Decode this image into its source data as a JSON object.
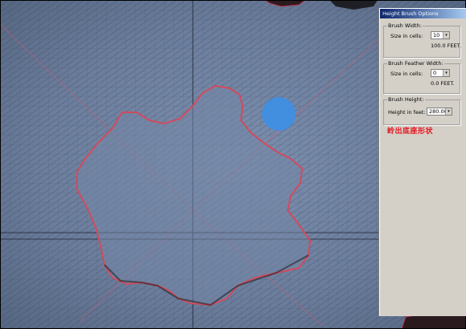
{
  "panel": {
    "title": "Height Brush Options",
    "brush_width": {
      "group_label": "Brush Width:",
      "field_label": "Size in cells:",
      "value": "10",
      "readout": "100.0 FEET."
    },
    "brush_feather_width": {
      "group_label": "Brush Feather Width:",
      "field_label": "Size in cells:",
      "value": "0",
      "readout": "0.0 FEET."
    },
    "brush_height": {
      "group_label": "Brush Height:",
      "field_label": "Height in feet:",
      "value": "280.00"
    }
  },
  "annotation": "岭出底座形状",
  "colors": {
    "terrain": "#6b7d9c",
    "brush_cursor": "#3d8fe6",
    "outline": "#d24a5e",
    "annotation": "#e8121e"
  },
  "icons": {
    "spin_button": "chevron-down-icon",
    "brush_cursor": "circle-brush-icon"
  }
}
